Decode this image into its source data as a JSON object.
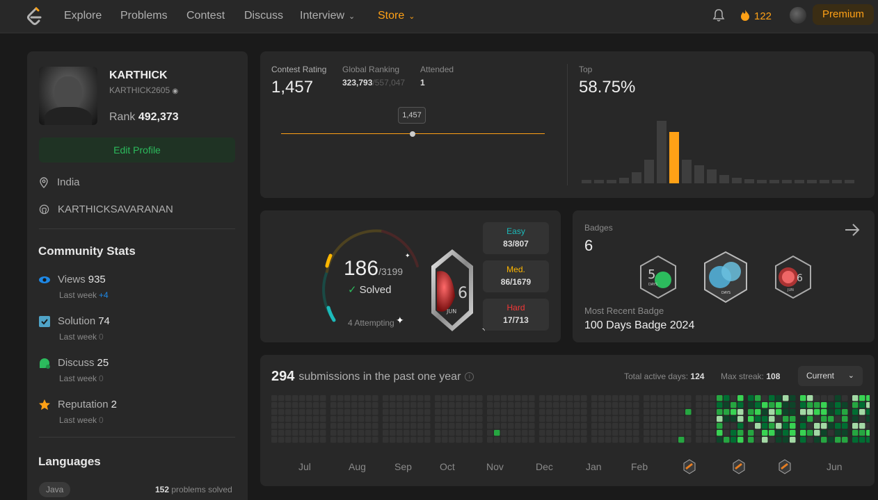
{
  "nav": {
    "items": [
      "Explore",
      "Problems",
      "Contest",
      "Discuss",
      "Interview"
    ],
    "store": "Store",
    "streak_count": "122",
    "premium": "Premium"
  },
  "profile": {
    "name": "KARTHICK",
    "handle": "KARTHICK2605",
    "rank_label": "Rank",
    "rank_value": "492,373",
    "edit_button": "Edit Profile",
    "location": "India",
    "github": "KARTHICKSAVARANAN"
  },
  "community": {
    "title": "Community Stats",
    "stats": [
      {
        "label": "Views",
        "value": "935",
        "sub": "Last week",
        "delta": "+4",
        "icon": "eye-icon"
      },
      {
        "label": "Solution",
        "value": "74",
        "sub": "Last week",
        "delta": "0",
        "icon": "solution-icon"
      },
      {
        "label": "Discuss",
        "value": "25",
        "sub": "Last week",
        "delta": "0",
        "icon": "discuss-icon"
      },
      {
        "label": "Reputation",
        "value": "2",
        "sub": "Last week",
        "delta": "0",
        "icon": "star-icon"
      }
    ]
  },
  "languages": {
    "title": "Languages",
    "items": [
      {
        "name": "Java",
        "count": "152",
        "suffix": "problems solved"
      }
    ]
  },
  "contest": {
    "rating_label": "Contest Rating",
    "rating": "1,457",
    "global_label": "Global Ranking",
    "global_rank": "323,793",
    "global_total": "/557,047",
    "attended_label": "Attended",
    "attended": "1",
    "tooltip": "1,457",
    "top_label": "Top",
    "top_value": "58.75%",
    "histogram": [
      0.05,
      0.05,
      0.05,
      0.08,
      0.16,
      0.34,
      0.9,
      0.74,
      0.34,
      0.26,
      0.2,
      0.12,
      0.08,
      0.06,
      0.05,
      0.05,
      0.05,
      0.05,
      0.05,
      0.05,
      0.05,
      0.05
    ],
    "highlight_index": 7,
    "highlight_color": "#ffa116"
  },
  "solved": {
    "count": "186",
    "total": "/3199",
    "label": "Solved",
    "attempting": "4 Attempting",
    "difficulties": [
      {
        "name": "Easy",
        "value": "83/807",
        "color": "#1cbaba"
      },
      {
        "name": "Med.",
        "value": "86/1679",
        "color": "#ffb700"
      },
      {
        "name": "Hard",
        "value": "17/713",
        "color": "#f63737"
      }
    ]
  },
  "badges": {
    "label": "Badges",
    "count": "6",
    "recent_label": "Most Recent Badge",
    "recent": "100 Days Badge 2024"
  },
  "submissions": {
    "count": "294",
    "text": "submissions in the past one year",
    "active_label": "Total active days:",
    "active_value": "124",
    "streak_label": "Max streak:",
    "streak_value": "108",
    "dropdown": "Current",
    "months": [
      "Jul",
      "Aug",
      "Sep",
      "Oct",
      "Nov",
      "Dec",
      "Jan",
      "Feb",
      "Jun"
    ]
  }
}
